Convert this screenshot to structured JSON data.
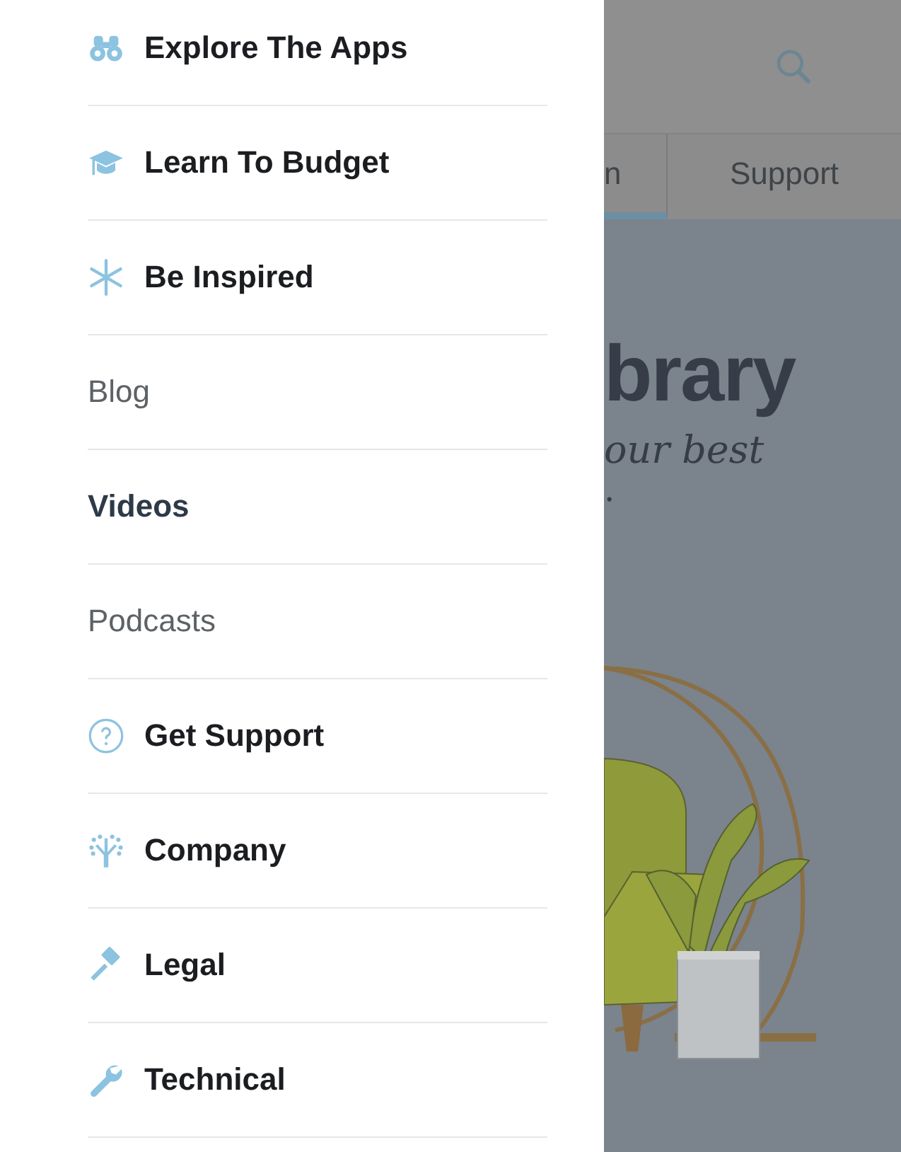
{
  "menu": {
    "items": [
      {
        "label": "Explore The Apps",
        "kind": "section"
      },
      {
        "label": "Learn To Budget",
        "kind": "section"
      },
      {
        "label": "Be Inspired",
        "kind": "section"
      },
      {
        "label": "Blog",
        "kind": "link",
        "selected": false
      },
      {
        "label": "Videos",
        "kind": "link",
        "selected": true
      },
      {
        "label": "Podcasts",
        "kind": "link",
        "selected": false
      },
      {
        "label": "Get Support",
        "kind": "section"
      },
      {
        "label": "Company",
        "kind": "section"
      },
      {
        "label": "Legal",
        "kind": "section"
      },
      {
        "label": "Technical",
        "kind": "section"
      }
    ]
  },
  "page": {
    "tabs": [
      {
        "label": "n",
        "selected": true
      },
      {
        "label": "Support",
        "selected": false
      }
    ],
    "heading": "brary",
    "subtitle": "our best",
    "subtitle_line_2": "."
  }
}
